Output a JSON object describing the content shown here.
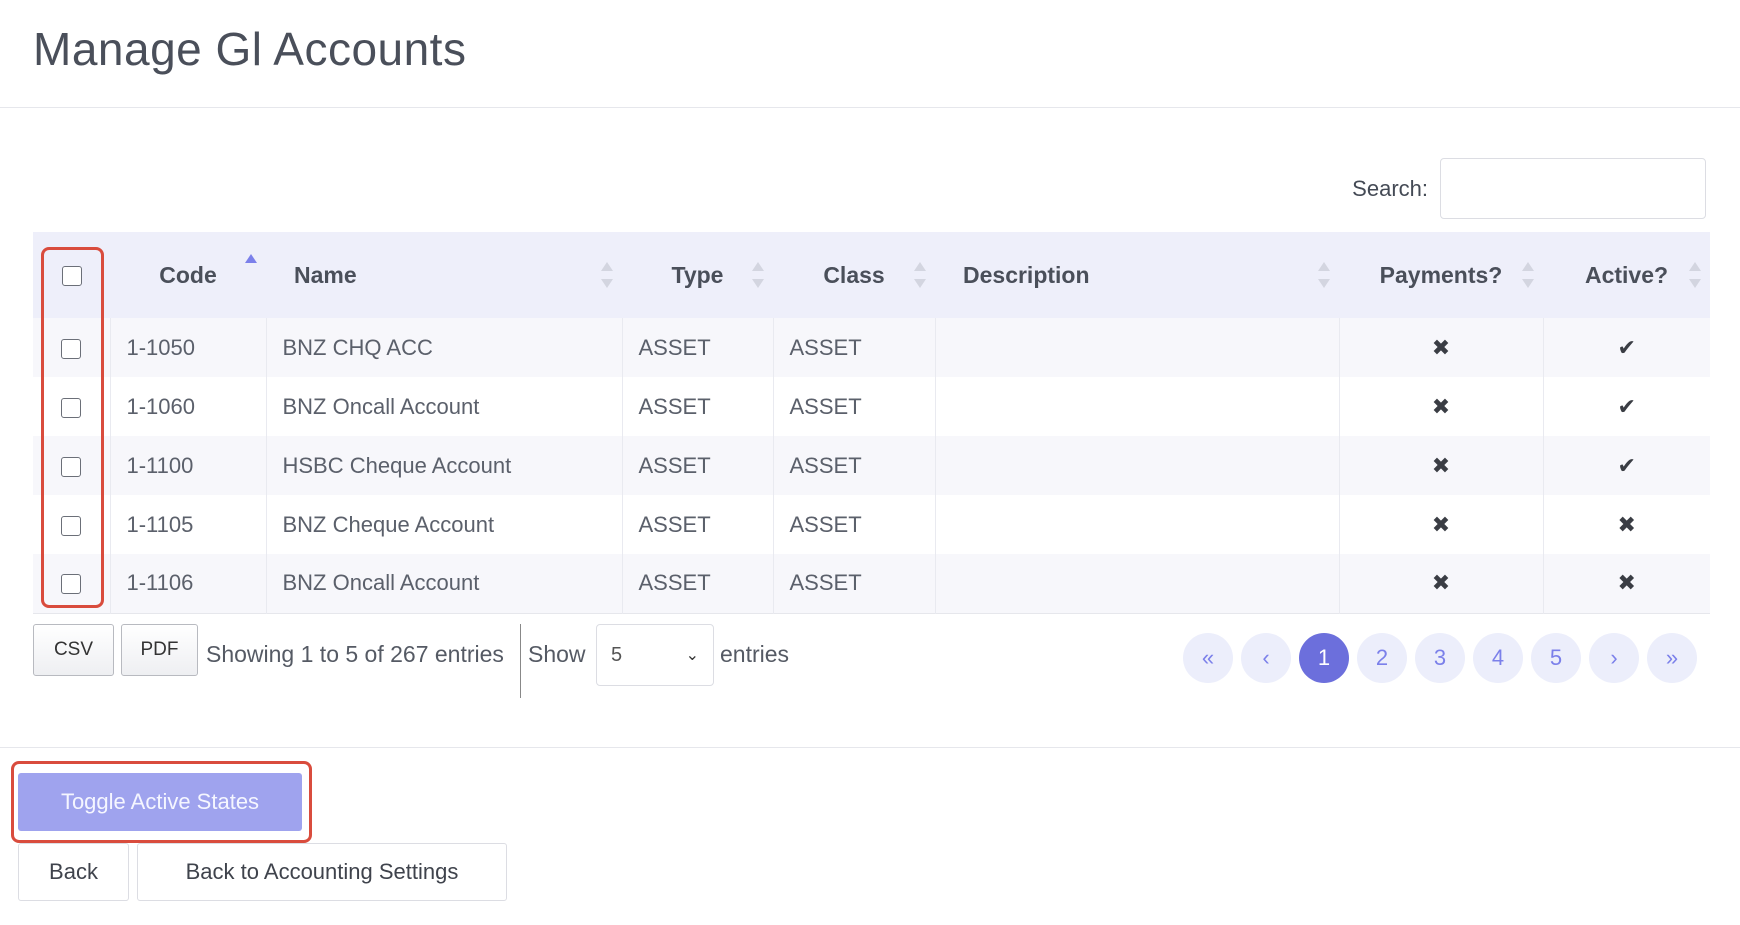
{
  "page": {
    "title": "Manage Gl Accounts"
  },
  "search": {
    "label": "Search:",
    "value": "",
    "placeholder": ""
  },
  "table": {
    "columns": [
      "",
      "Code",
      "Name",
      "Type",
      "Class",
      "Description",
      "Payments?",
      "Active?"
    ],
    "sorted_column": "Code",
    "rows": [
      {
        "code": "1-1050",
        "name": "BNZ CHQ ACC",
        "type": "ASSET",
        "class": "ASSET",
        "description": "",
        "payments": "✖",
        "active": "✔"
      },
      {
        "code": "1-1060",
        "name": "BNZ Oncall Account",
        "type": "ASSET",
        "class": "ASSET",
        "description": "",
        "payments": "✖",
        "active": "✔"
      },
      {
        "code": "1-1100",
        "name": "HSBC Cheque Account",
        "type": "ASSET",
        "class": "ASSET",
        "description": "",
        "payments": "✖",
        "active": "✔"
      },
      {
        "code": "1-1105",
        "name": "BNZ Cheque Account",
        "type": "ASSET",
        "class": "ASSET",
        "description": "",
        "payments": "✖",
        "active": "✖"
      },
      {
        "code": "1-1106",
        "name": "BNZ Oncall Account",
        "type": "ASSET",
        "class": "ASSET",
        "description": "",
        "payments": "✖",
        "active": "✖"
      }
    ]
  },
  "footer": {
    "csv_label": "CSV",
    "pdf_label": "PDF",
    "info": "Showing 1 to 5 of 267 entries",
    "show_label": "Show",
    "page_length": "5",
    "entries_label": "entries"
  },
  "pagination": {
    "first": "«",
    "prev": "‹",
    "pages": [
      "1",
      "2",
      "3",
      "4",
      "5"
    ],
    "current": "1",
    "next": "›",
    "last": "»"
  },
  "actions": {
    "toggle_label": "Toggle Active States",
    "back_label": "Back",
    "back_settings_label": "Back to Accounting Settings"
  },
  "colors": {
    "accent": "#6c6fdc",
    "accent_light": "#9fa3ee",
    "highlight": "#d94c3d",
    "header_bg": "#eeeffa"
  }
}
